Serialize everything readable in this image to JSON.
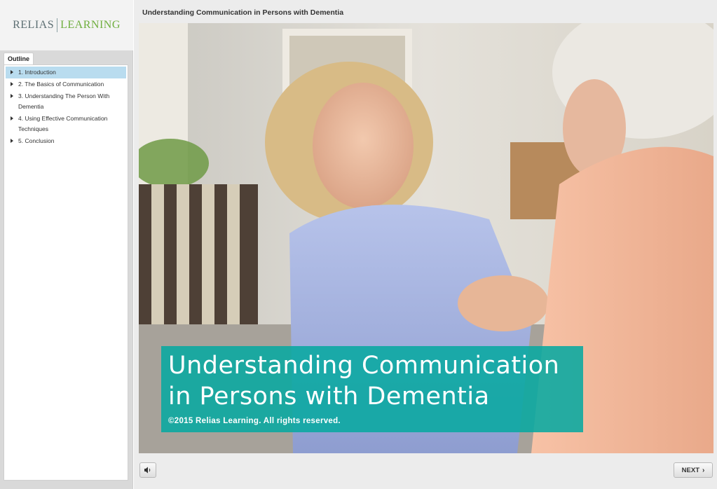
{
  "sidebar": {
    "logo": {
      "left": "RELIAS",
      "right": "LEARNING"
    },
    "outline_tab": "Outline",
    "items": [
      {
        "label": "1. Introduction",
        "active": true
      },
      {
        "label": "2. The Basics of Communication",
        "active": false
      },
      {
        "label": "3. Understanding The Person With Dementia",
        "active": false
      },
      {
        "label": "4. Using Effective Communication Techniques",
        "active": false
      },
      {
        "label": "5. Conclusion",
        "active": false
      }
    ]
  },
  "header": {
    "title": "Understanding Communication in Persons with Dementia"
  },
  "slide": {
    "title_line1": "Understanding Communication",
    "title_line2": "in Persons with Dementia",
    "copyright": "©2015 Relias Learning. All rights reserved.",
    "accent": "#0aa79f"
  },
  "controls": {
    "audio_icon": "speaker-icon",
    "next_label": "NEXT",
    "next_icon": "chevron-right-icon"
  }
}
